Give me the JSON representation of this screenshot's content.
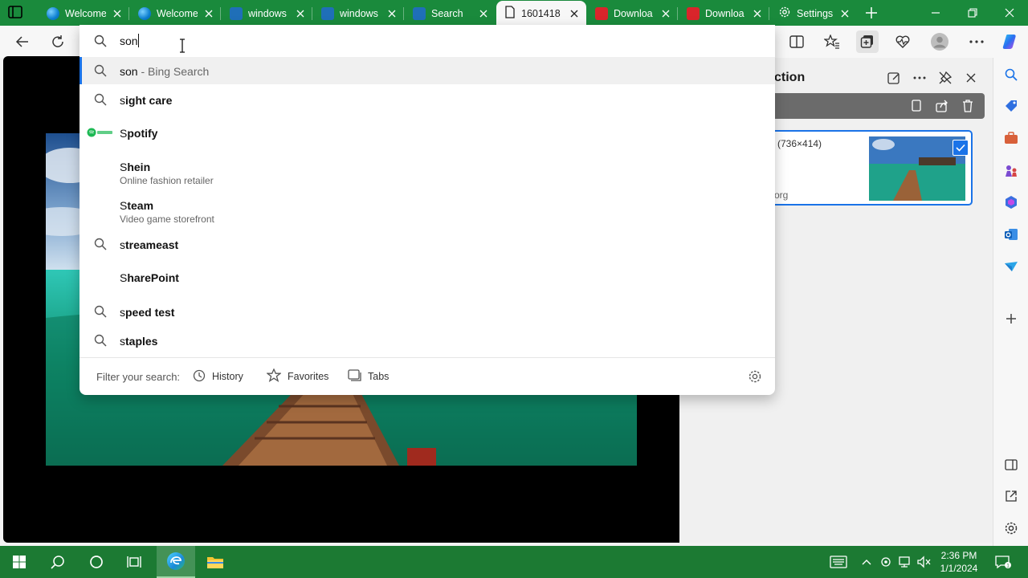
{
  "tabs": [
    {
      "title": "Welcome",
      "icon": "edge-icon"
    },
    {
      "title": "Welcome",
      "icon": "edge-icon"
    },
    {
      "title": "windows",
      "icon": "bing-icon"
    },
    {
      "title": "windows",
      "icon": "bing-icon"
    },
    {
      "title": "Search",
      "icon": "bing-icon"
    },
    {
      "title": "1601418",
      "icon": "file-icon"
    },
    {
      "title": "Downloa",
      "icon": "download-icon"
    },
    {
      "title": "Downloa",
      "icon": "download-icon"
    },
    {
      "title": "Settings",
      "icon": "gear-icon"
    }
  ],
  "address": {
    "value": "son"
  },
  "suggestions": [
    {
      "pre": "son",
      "post": " - Bing Search",
      "icon": "search-icon"
    },
    {
      "first": "s",
      "rest": "ight care",
      "icon": "search-icon"
    },
    {
      "first": "S",
      "rest": "potify",
      "icon": "spotify-icon"
    },
    {
      "first": "S",
      "rest": "hein",
      "sub": "Online fashion retailer",
      "icon": "none"
    },
    {
      "first": "S",
      "rest": "team",
      "sub": "Video game storefront",
      "icon": "none"
    },
    {
      "first": "s",
      "rest": "treameast",
      "icon": "search-icon"
    },
    {
      "first": "S",
      "rest": "harePoint",
      "icon": "none"
    },
    {
      "first": "s",
      "rest": "peed test",
      "icon": "search-icon"
    },
    {
      "first": "s",
      "rest": "taples",
      "icon": "search-icon"
    }
  ],
  "filter": {
    "label": "Filter your search:",
    "history": "History",
    "favorites": "Favorites",
    "tabs": "Tabs"
  },
  "collections": {
    "title_fragment": "ction",
    "card_dims": "(736×414)",
    "card_source_fragment": "org"
  },
  "taskbar": {
    "time": "2:36 PM",
    "date": "1/1/2024"
  },
  "colors": {
    "tabstrip": "#1a8a3c",
    "taskbar": "#1c7a33",
    "accent": "#1a73e8"
  }
}
